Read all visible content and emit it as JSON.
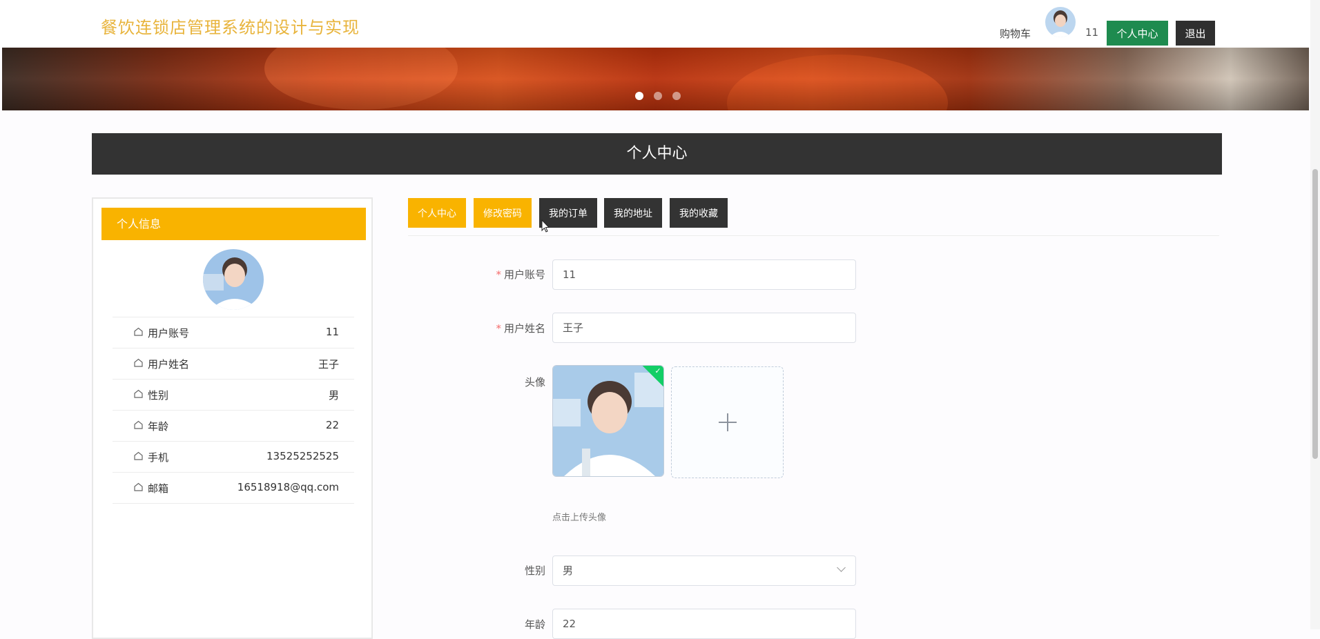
{
  "header": {
    "site_title": "餐饮连锁店管理系统的设计与实现",
    "cart_label": "购物车",
    "username": "11",
    "center_button": "个人中心",
    "logout_button": "退出"
  },
  "section": {
    "title": "个人中心"
  },
  "profile_panel": {
    "title": "个人信息",
    "rows": [
      {
        "label": "用户账号",
        "value": "11"
      },
      {
        "label": "用户姓名",
        "value": "王子"
      },
      {
        "label": "性别",
        "value": "男"
      },
      {
        "label": "年龄",
        "value": "22"
      },
      {
        "label": "手机",
        "value": "13525252525"
      },
      {
        "label": "邮箱",
        "value": "16518918@qq.com"
      }
    ]
  },
  "tabs": [
    {
      "label": "个人中心"
    },
    {
      "label": "修改密码"
    },
    {
      "label": "我的订单"
    },
    {
      "label": "我的地址"
    },
    {
      "label": "我的收藏"
    }
  ],
  "form": {
    "account": {
      "label": "用户账号",
      "value": "11"
    },
    "name": {
      "label": "用户姓名",
      "value": "王子"
    },
    "avatar": {
      "label": "头像",
      "hint": "点击上传头像"
    },
    "gender": {
      "label": "性别",
      "value": "男"
    },
    "age": {
      "label": "年龄",
      "value": "22"
    }
  },
  "colors": {
    "accent_yellow": "#f9b300",
    "dark": "#333333",
    "green": "#1e8b4f",
    "title_gold": "#e8b43c"
  },
  "icons": [
    "home-icon",
    "plus-icon",
    "chevron-down-icon",
    "check-icon"
  ]
}
